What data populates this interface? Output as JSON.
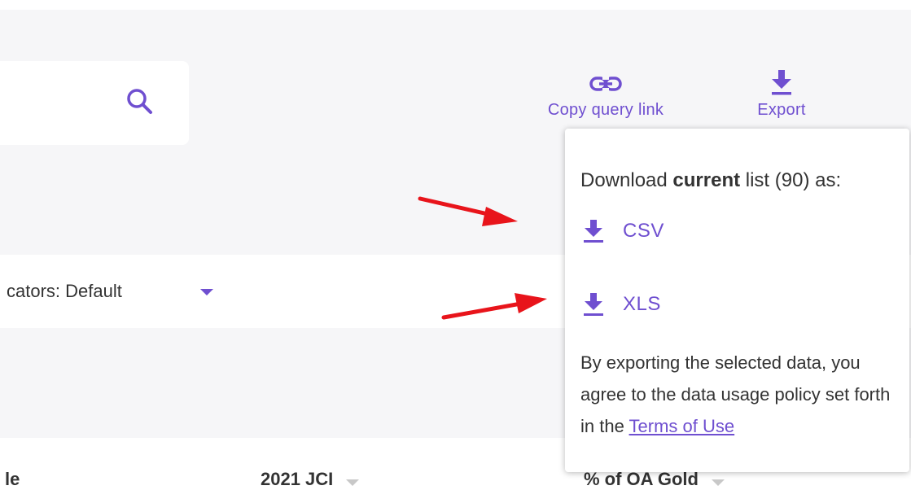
{
  "colors": {
    "accent": "#6f4fd0",
    "annotation_arrow": "#e8141b",
    "background_gray": "#f6f6f8",
    "text": "#333333"
  },
  "search": {
    "icon": "search-icon"
  },
  "toolbar": {
    "copy_link": {
      "label": "Copy query link",
      "icon": "link-icon"
    },
    "export": {
      "label": "Export",
      "icon": "download-icon"
    }
  },
  "indicators": {
    "label": "cators: Default",
    "icon": "chevron-down-icon"
  },
  "table": {
    "headers": [
      "le",
      "2021 JCI",
      "% of OA Gold"
    ]
  },
  "export_menu": {
    "heading_prefix": "Download ",
    "heading_bold": "current",
    "heading_suffix": " list (90) as:",
    "options": [
      {
        "label": "CSV",
        "icon": "download-icon"
      },
      {
        "label": "XLS",
        "icon": "download-icon"
      }
    ],
    "policy_text": "By exporting the selected data, you agree to the data usage policy set forth in the ",
    "policy_link": "Terms of Use"
  },
  "annotations": {
    "arrows": [
      "red-arrow-to-csv",
      "red-arrow-to-xls"
    ]
  }
}
